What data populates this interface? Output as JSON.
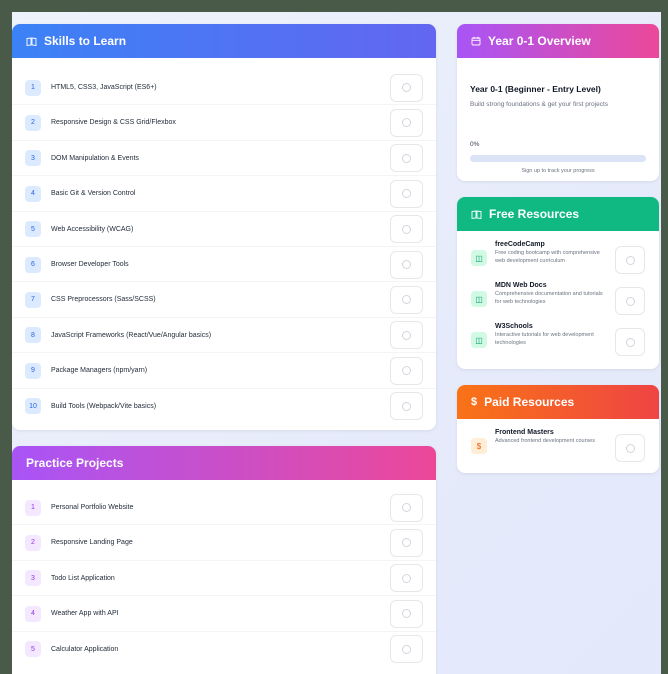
{
  "skills": {
    "title": "Skills to Learn",
    "icon": "book-icon",
    "items": [
      {
        "num": "1",
        "label": "HTML5, CSS3, JavaScript (ES6+)"
      },
      {
        "num": "2",
        "label": "Responsive Design & CSS Grid/Flexbox"
      },
      {
        "num": "3",
        "label": "DOM Manipulation & Events"
      },
      {
        "num": "4",
        "label": "Basic Git & Version Control"
      },
      {
        "num": "5",
        "label": "Web Accessibility (WCAG)"
      },
      {
        "num": "6",
        "label": "Browser Developer Tools"
      },
      {
        "num": "7",
        "label": "CSS Preprocessors (Sass/SCSS)"
      },
      {
        "num": "8",
        "label": "JavaScript Frameworks (React/Vue/Angular basics)"
      },
      {
        "num": "9",
        "label": "Package Managers (npm/yarn)"
      },
      {
        "num": "10",
        "label": "Build Tools (Webpack/Vite basics)"
      }
    ]
  },
  "projects": {
    "title": "Practice Projects",
    "items": [
      {
        "num": "1",
        "label": "Personal Portfolio Website"
      },
      {
        "num": "2",
        "label": "Responsive Landing Page"
      },
      {
        "num": "3",
        "label": "Todo List Application"
      },
      {
        "num": "4",
        "label": "Weather App with API"
      },
      {
        "num": "5",
        "label": "Calculator Application"
      }
    ]
  },
  "overview": {
    "header": "Year 0-1 Overview",
    "icon": "calendar-icon",
    "title": "Year 0-1 (Beginner - Entry Level)",
    "description": "Build strong foundations & get your first projects",
    "progress_label": "0%",
    "progress_value": 0,
    "cta": "Sign up to track your progress"
  },
  "free_resources": {
    "title": "Free Resources",
    "icon": "book-icon",
    "items": [
      {
        "name": "freeCodeCamp",
        "desc": "Free coding bootcamp with comprehensive web development curriculum"
      },
      {
        "name": "MDN Web Docs",
        "desc": "Comprehensive documentation and tutorials for web technologies"
      },
      {
        "name": "W3Schools",
        "desc": "Interactive tutorials for web development technologies"
      }
    ]
  },
  "paid_resources": {
    "title": "Paid Resources",
    "icon": "dollar-icon",
    "items": [
      {
        "name": "Frontend Masters",
        "desc": "Advanced frontend development courses"
      }
    ]
  },
  "colors": {
    "skills_header": "#3b82f6",
    "projects_header": "#a855f7",
    "free_header": "#10b981",
    "paid_header": "#f97316"
  }
}
